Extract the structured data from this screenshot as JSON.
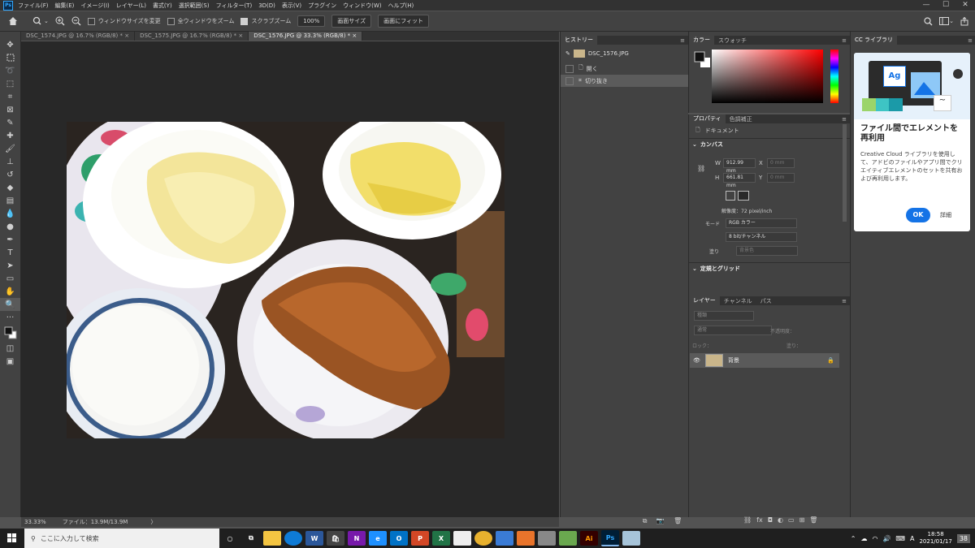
{
  "app": {
    "logo": "Ps"
  },
  "menu": [
    "ファイル(F)",
    "編集(E)",
    "イメージ(I)",
    "レイヤー(L)",
    "書式(Y)",
    "選択範囲(S)",
    "フィルター(T)",
    "3D(D)",
    "表示(V)",
    "プラグイン",
    "ウィンドウ(W)",
    "ヘルプ(H)"
  ],
  "window_controls": {
    "minimize": "—",
    "maximize": "☐",
    "close": "✕"
  },
  "options": {
    "resize_windows": "ウィンドウサイズを変更",
    "zoom_all": "全ウィンドウをズーム",
    "scrubby_zoom": "スクラブズーム",
    "zoom_value": "100%",
    "fit_screen": "画面サイズ",
    "fill_screen": "画面にフィット"
  },
  "doc_tabs": [
    {
      "label": "DSC_1574.JPG @ 16.7% (RGB/8) *",
      "active": false
    },
    {
      "label": "DSC_1575.JPG @ 16.7% (RGB/8) *",
      "active": false
    },
    {
      "label": "DSC_1576.JPG @ 33.3% (RGB/8) *",
      "active": true
    }
  ],
  "status": {
    "zoom": "33.33%",
    "file": "ファイル：13.9M/13.9M",
    "arrow": "〉"
  },
  "history": {
    "title": "ヒストリー",
    "snapshot": "DSC_1576.JPG",
    "items": [
      "開く",
      "切り抜き"
    ]
  },
  "color_panel": {
    "tabs": [
      "カラー",
      "スウォッチ"
    ]
  },
  "properties": {
    "tabs": [
      "プロパティ",
      "色調補正"
    ],
    "doc_label": "ドキュメント",
    "canvas_title": "カンバス",
    "w_label": "W",
    "w_value": "912.99 mm",
    "h_label": "H",
    "h_value": "661.81 mm",
    "x_label": "X",
    "x_value": "0 mm",
    "y_label": "Y",
    "y_value": "0 mm",
    "resolution": "解像度：72 pixel/inch",
    "mode_label": "モード",
    "mode_value": "RGB カラー",
    "depth_value": "8 bit/チャンネル",
    "fill_label": "塗り",
    "fill_value": "背景色",
    "guides_title": "定規とグリッド"
  },
  "layers": {
    "tabs": [
      "レイヤー",
      "チャンネル",
      "パス"
    ],
    "kind": "種類",
    "blend": "通常",
    "opacity_label": "不透明度：",
    "lock_label": "ロック：",
    "fill_label": "塗り：",
    "layer_name": "背景"
  },
  "cc": {
    "tab": "CC ライブラリ",
    "art_label": "Ag",
    "heading": "ファイル間でエレメントを再利用",
    "body": "Creative Cloud ライブラリを使用して、アドビのファイルやアプリ間でクリエイティブエレメントのセットを共有および再利用します。",
    "ok": "OK",
    "details": "詳細"
  },
  "taskbar": {
    "search_placeholder": "ここに入力して検索",
    "time": "18:58",
    "date": "2021/01/17",
    "ime": "A",
    "notif_count": "38",
    "apps": [
      {
        "label": "W",
        "color": "#2b579a"
      },
      {
        "label": "N",
        "color": "#7719aa"
      },
      {
        "label": "e",
        "color": "#1e90ff"
      },
      {
        "label": "O",
        "color": "#0072c6"
      },
      {
        "label": "P",
        "color": "#d24726"
      },
      {
        "label": "X",
        "color": "#217346"
      },
      {
        "label": "Ai",
        "color": "#ff9a00"
      },
      {
        "label": "Ps",
        "color": "#31a8ff"
      }
    ]
  }
}
